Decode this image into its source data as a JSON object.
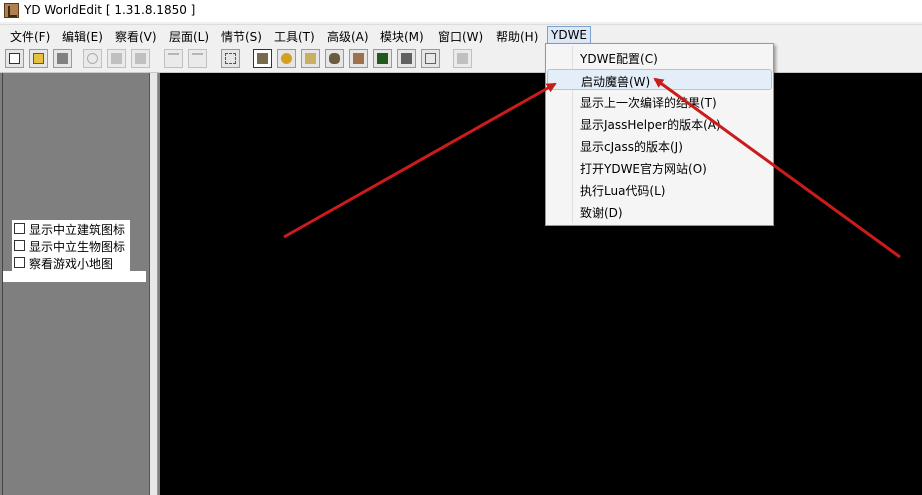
{
  "window": {
    "title": "YD WorldEdit [ 1.31.8.1850 ]"
  },
  "menubar": {
    "items": [
      {
        "label": "文件(F)"
      },
      {
        "label": "编辑(E)"
      },
      {
        "label": "察看(V)"
      },
      {
        "label": "层面(L)"
      },
      {
        "label": "情节(S)"
      },
      {
        "label": "工具(T)"
      },
      {
        "label": "高级(A)"
      },
      {
        "label": "模块(M)"
      },
      {
        "label": "窗口(W)"
      },
      {
        "label": "帮助(H)"
      },
      {
        "label": "YDWE"
      }
    ]
  },
  "toolbar": {
    "buttons": [
      "new-icon",
      "open-icon",
      "save-icon",
      "cut-icon",
      "copy-icon",
      "paste-icon",
      "undo-icon",
      "redo-icon",
      "select-icon",
      "terrain-icon",
      "doodad-icon",
      "sound-icon",
      "unit-icon",
      "region-icon",
      "camera-icon",
      "object-editor-icon",
      "test-map-icon",
      "import-icon"
    ]
  },
  "left_panel": {
    "checkboxes": [
      {
        "label": "显示中立建筑图标",
        "checked": false
      },
      {
        "label": "显示中立生物图标",
        "checked": false
      },
      {
        "label": "察看游戏小地图",
        "checked": false
      }
    ]
  },
  "ydwe_menu": {
    "items": [
      {
        "label": "YDWE配置(C)"
      },
      {
        "label": "启动魔兽(W)"
      },
      {
        "label": "显示上一次编译的结果(T)"
      },
      {
        "label": "显示JassHelper的版本(A)"
      },
      {
        "label": "显示cJass的版本(J)"
      },
      {
        "label": "打开YDWE官方网站(O)"
      },
      {
        "label": "执行Lua代码(L)"
      },
      {
        "label": "致谢(D)"
      }
    ],
    "highlighted": "启动魔兽(W)"
  },
  "colors": {
    "arrow": "#cc1b1b",
    "canvas": "#000000",
    "highlight": "#e3eef9"
  }
}
